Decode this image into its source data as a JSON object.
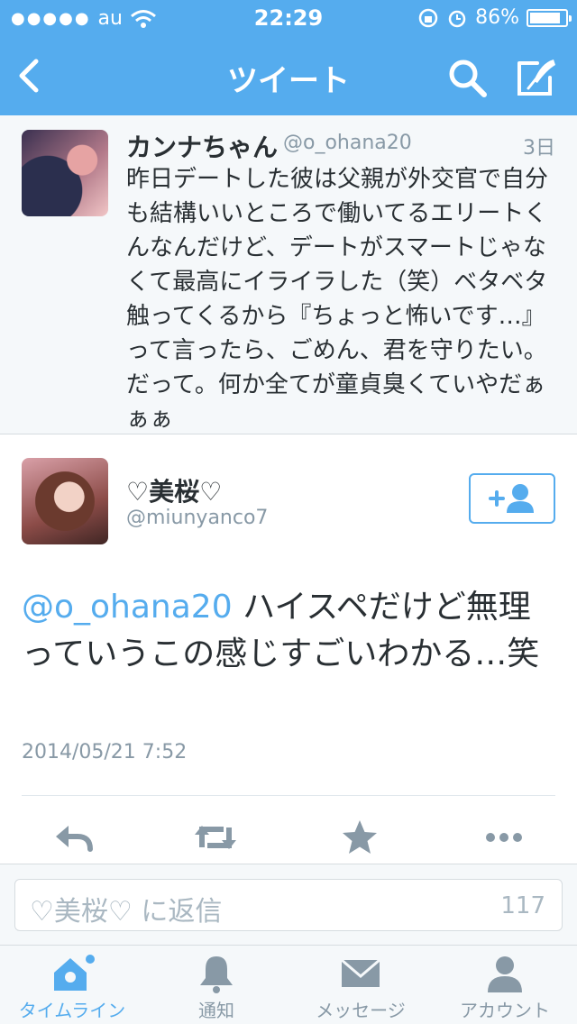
{
  "status_bar": {
    "carrier": "au",
    "time": "22:29",
    "battery": "86%",
    "battery_level": 0.86
  },
  "nav": {
    "title": "ツイート",
    "icons": [
      "back-chevron-icon",
      "search-icon",
      "compose-icon"
    ]
  },
  "parent_tweet": {
    "name": "カンナちゃん",
    "handle": "@o_ohana20",
    "time": "3日",
    "text": "昨日デートした彼は父親が外交官で自分も結構いいところで働いてるエリートくんなんだけど、デートがスマートじゃなくて最高にイライラした（笑）ベタベタ触ってくるから『ちょっと怖いです…』って言ったら、ごめん、君を守りたい。だって。何か全てが童貞臭くていやだぁぁぁ"
  },
  "focused_tweet": {
    "name": "♡美桜♡",
    "handle": "@miunyanco7",
    "mention": "@o_ohana20",
    "text": " ハイスペだけど無理っていうこの感じすごいわかる…笑",
    "date": "2014/05/21 7:52"
  },
  "actions": [
    "reply-icon",
    "retweet-icon",
    "favorite-icon",
    "more-icon"
  ],
  "reply_bar": {
    "placeholder": "♡美桜♡ に返信",
    "char_count": "117"
  },
  "tabbar": {
    "tabs": [
      {
        "label": "タイムライン",
        "icon": "home-icon",
        "active": true
      },
      {
        "label": "通知",
        "icon": "bell-icon",
        "active": false
      },
      {
        "label": "メッセージ",
        "icon": "envelope-icon",
        "active": false
      },
      {
        "label": "アカウント",
        "icon": "person-icon",
        "active": false
      }
    ]
  },
  "colors": {
    "accent": "#55acee",
    "text": "#292f33",
    "muted": "#8899a6",
    "icon": "#8899a6"
  }
}
